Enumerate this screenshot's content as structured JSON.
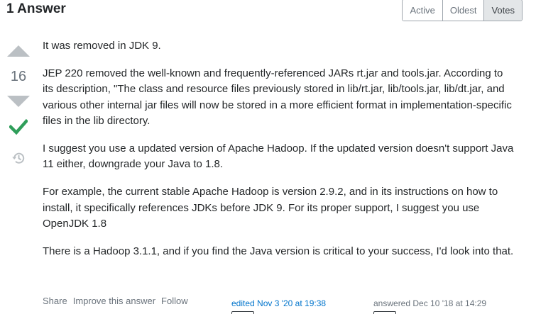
{
  "header": {
    "answer_count": "1 Answer",
    "sort_tabs": [
      "Active",
      "Oldest",
      "Votes"
    ],
    "active_tab": "Votes"
  },
  "votes": {
    "count": "16",
    "accepted": true,
    "icons": {
      "up": "vote-up-arrow-icon",
      "down": "vote-down-arrow-icon",
      "accepted": "accepted-check-icon",
      "history": "history-icon"
    }
  },
  "post": {
    "paragraphs": [
      "It was removed in JDK 9.",
      "JEP 220 removed the well-known and frequently-referenced JARs rt.jar and tools.jar. According to its description, \"The class and resource files previously stored in lib/rt.jar, lib/tools.jar, lib/dt.jar, and various other internal jar files will now be stored in a more efficient format in implementation-specific files in the lib directory.",
      "I suggest you use a updated version of Apache Hadoop. If the updated version doesn't support Java 11 either, downgrade your Java to 1.8.",
      "For example, the current stable Apache Hadoop is version 2.9.2, and in its instructions on how to install, it specifically references JDKs before JDK 9. For its proper support, I suggest you use OpenJDK 1.8",
      "There is a Hadoop 3.1.1, and if you find the Java version is critical to your success, I'd look into that."
    ]
  },
  "post_menu": {
    "share": "Share",
    "improve": "Improve this answer",
    "follow": "Follow"
  },
  "signature": {
    "edited": "edited Nov 3 '20 at 19:38",
    "answered_prefix": "answered",
    "answered_date": "Dec 10 '18 at 14:29"
  },
  "colors": {
    "accepted_green": "#2f9e5a",
    "vote_arrow": "#bbc0c4",
    "link_blue": "#0074cc",
    "tab_active_bg": "#e3e6e8"
  }
}
